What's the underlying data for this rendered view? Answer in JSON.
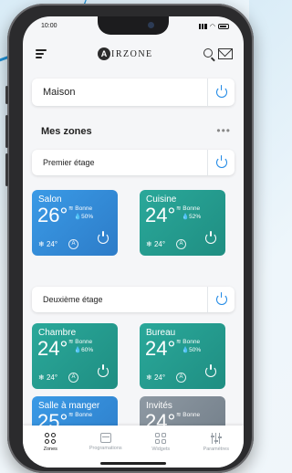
{
  "status_bar": {
    "time": "10:00"
  },
  "header": {
    "brand_letter": "A",
    "brand_rest": "IRZONE"
  },
  "home": {
    "label": "Maison"
  },
  "zones_section": {
    "title": "Mes zones",
    "more": "•••"
  },
  "floors": [
    {
      "label": "Premier étage",
      "zones": [
        {
          "name": "Salon",
          "temp": "26°",
          "air": "Bonne",
          "humidity": "50%",
          "setpoint": "24°",
          "mode_icon": "auto-icon",
          "color": "#3a9ae6"
        },
        {
          "name": "Cuisine",
          "temp": "24°",
          "air": "Bonne",
          "humidity": "52%",
          "setpoint": "24°",
          "mode_icon": "auto-icon",
          "color": "#2aa89a"
        }
      ]
    },
    {
      "label": "Deuxième étage",
      "zones": [
        {
          "name": "Chambre",
          "temp": "24°",
          "air": "Bonne",
          "humidity": "60%",
          "setpoint": "24°",
          "mode_icon": "auto-icon",
          "color": "#2aa89a"
        },
        {
          "name": "Bureau",
          "temp": "24°",
          "air": "Bonne",
          "humidity": "50%",
          "setpoint": "24°",
          "mode_icon": "auto-icon",
          "color": "#2aa89a"
        },
        {
          "name": "Salle à manger",
          "temp": "25°",
          "air": "Bonne",
          "color": "#3a9ae6"
        },
        {
          "name": "Invités",
          "temp": "24°",
          "air": "Bonne",
          "color": "#8e99a3"
        }
      ]
    }
  ],
  "tabs": [
    {
      "label": "Zones",
      "icon": "zones-icon",
      "active": true
    },
    {
      "label": "Programations",
      "icon": "calendar-icon"
    },
    {
      "label": "Widgets",
      "icon": "widgets-icon"
    },
    {
      "label": "Paramètres",
      "icon": "settings-sliders-icon"
    }
  ],
  "colors": {
    "accent": "#1e88e5",
    "teal": "#2aa89a",
    "blue_zone": "#3a9ae6"
  }
}
